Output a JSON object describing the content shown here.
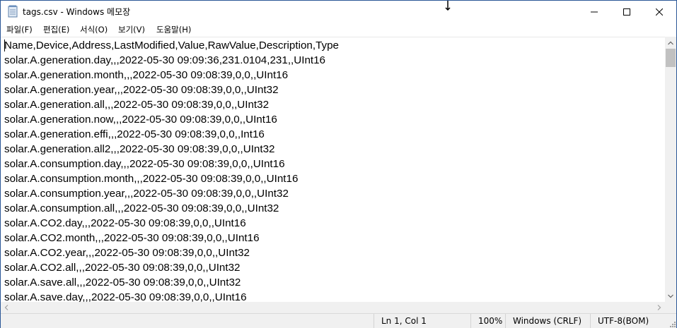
{
  "window": {
    "title": "tags.csv - Windows 메모장"
  },
  "menu": [
    {
      "label": "파일(F)",
      "name": "menu-file"
    },
    {
      "label": "편집(E)",
      "name": "menu-edit"
    },
    {
      "label": "서식(O)",
      "name": "menu-format"
    },
    {
      "label": "보기(V)",
      "name": "menu-view"
    },
    {
      "label": "도움말(H)",
      "name": "menu-help"
    }
  ],
  "content": {
    "lines": [
      "Name,Device,Address,LastModified,Value,RawValue,Description,Type",
      "solar.A.generation.day,,,2022-05-30 09:09:36,231.0104,231,,UInt16",
      "solar.A.generation.month,,,2022-05-30 09:08:39,0,0,,UInt16",
      "solar.A.generation.year,,,2022-05-30 09:08:39,0,0,,UInt32",
      "solar.A.generation.all,,,2022-05-30 09:08:39,0,0,,UInt32",
      "solar.A.generation.now,,,2022-05-30 09:08:39,0,0,,UInt16",
      "solar.A.generation.effi,,,2022-05-30 09:08:39,0,0,,Int16",
      "solar.A.generation.all2,,,2022-05-30 09:08:39,0,0,,UInt32",
      "solar.A.consumption.day,,,2022-05-30 09:08:39,0,0,,UInt16",
      "solar.A.consumption.month,,,2022-05-30 09:08:39,0,0,,UInt16",
      "solar.A.consumption.year,,,2022-05-30 09:08:39,0,0,,UInt32",
      "solar.A.consumption.all,,,2022-05-30 09:08:39,0,0,,UInt32",
      "solar.A.CO2.day,,,2022-05-30 09:08:39,0,0,,UInt16",
      "solar.A.CO2.month,,,2022-05-30 09:08:39,0,0,,UInt16",
      "solar.A.CO2.year,,,2022-05-30 09:08:39,0,0,,UInt32",
      "solar.A.CO2.all,,,2022-05-30 09:08:39,0,0,,UInt32",
      "solar.A.save.all,,,2022-05-30 09:08:39,0,0,,UInt32",
      "solar.A.save.day,,,2022-05-30 09:08:39,0,0,,UInt16"
    ]
  },
  "status": {
    "position": "Ln 1, Col 1",
    "zoom": "100%",
    "line_ending": "Windows (CRLF)",
    "encoding": "UTF-8(BOM)"
  },
  "icons": {
    "app": "notepad-icon",
    "minimize": "minimize-icon",
    "maximize": "maximize-icon",
    "close": "close-icon"
  }
}
